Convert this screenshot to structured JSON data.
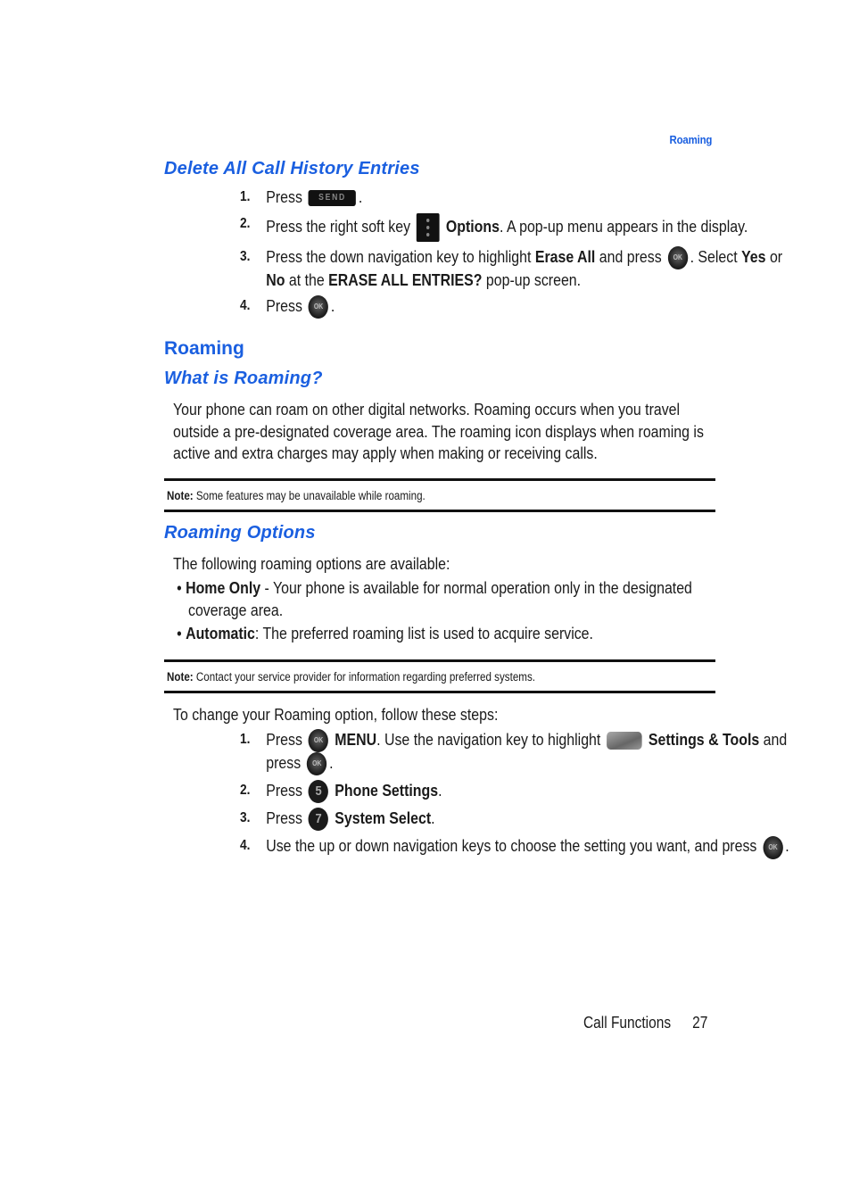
{
  "running_head": "Roaming",
  "section1": {
    "title": "Delete All Call History Entries",
    "steps": [
      {
        "num": "1.",
        "parts": {
          "a": "Press",
          "key": "SEND",
          "b": "."
        }
      },
      {
        "num": "2.",
        "parts": {
          "a": "Press the right soft key",
          "bold1": "Options",
          "b": ". A pop-up menu appears in the display."
        }
      },
      {
        "num": "3.",
        "parts": {
          "a": "Press the down navigation key to highlight",
          "bold1": "Erase All",
          "b": "and press",
          "c": ". Select",
          "bold2": "Yes",
          "d": "or",
          "bold3": "No",
          "e": "at the",
          "bold4": "ERASE ALL ENTRIES?",
          "f": "pop-up screen."
        }
      },
      {
        "num": "4.",
        "parts": {
          "a": "Press",
          "b": "."
        }
      }
    ]
  },
  "section2": {
    "title": "Roaming",
    "sub1": {
      "title": "What is Roaming?",
      "paragraph": "Your phone can roam on other digital networks. Roaming occurs when you travel outside a pre-designated coverage area. The roaming icon displays when roaming is active and extra charges may apply when making or receiving calls.",
      "note_label": "Note:",
      "note_text": "Some features may be unavailable while roaming."
    },
    "sub2": {
      "title": "Roaming Options",
      "intro": "The following roaming options are available:",
      "bullets": [
        {
          "bold": "Home Only",
          "text": " - Your phone is available for normal operation only in the designated coverage area."
        },
        {
          "bold": "Automatic",
          "text": ": The preferred roaming list is used to acquire service."
        }
      ],
      "note_label": "Note:",
      "note_text": "Contact your service provider for information regarding preferred systems.",
      "steps_intro": "To change your Roaming option, follow these steps:",
      "steps": [
        {
          "num": "1.",
          "parts": {
            "a": "Press",
            "bold1": "MENU",
            "b": ". Use the navigation key to highlight",
            "bold2": "Settings & Tools",
            "c": "and press",
            "d": "."
          }
        },
        {
          "num": "2.",
          "parts": {
            "a": "Press",
            "key": "5",
            "bold1": "Phone Settings",
            "b": "."
          }
        },
        {
          "num": "3.",
          "parts": {
            "a": "Press",
            "key": "7",
            "bold1": "System Select",
            "b": "."
          }
        },
        {
          "num": "4.",
          "parts": {
            "a": "Use the up or down navigation keys to choose the setting you want, and press",
            "b": "."
          }
        }
      ]
    }
  },
  "icons": {
    "ok_key": "OK",
    "send_key": "SEND"
  },
  "footer": {
    "section": "Call Functions",
    "page": "27"
  },
  "colors": {
    "heading": "#1a5fe0",
    "text": "#1a1a1a"
  }
}
